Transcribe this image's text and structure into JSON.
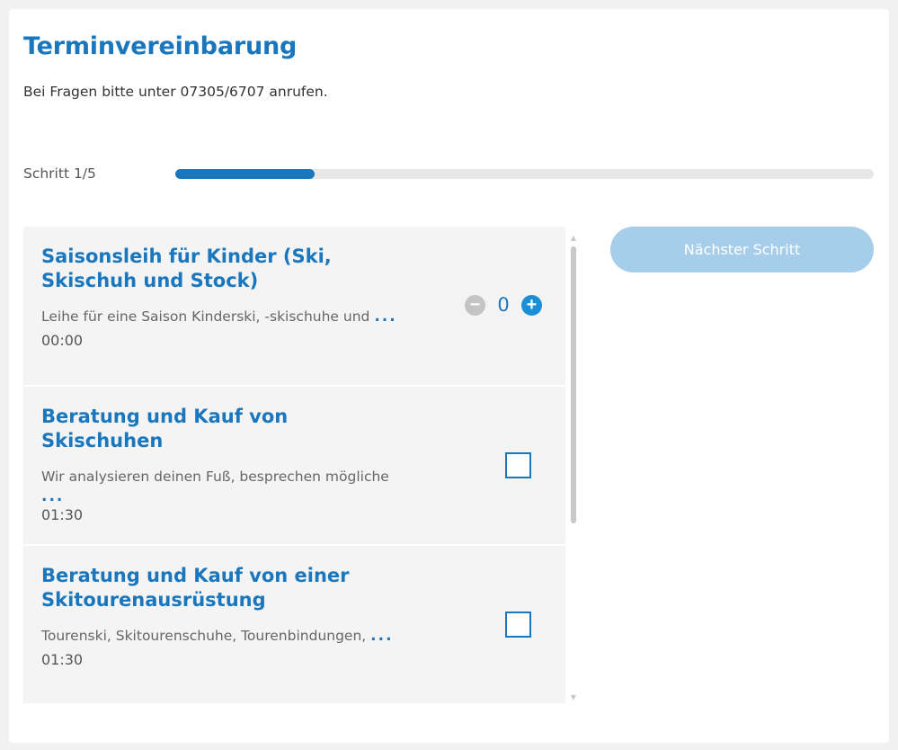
{
  "header": {
    "title": "Terminvereinbarung",
    "subtitle": "Bei Fragen bitte unter 07305/6707 anrufen."
  },
  "progress": {
    "label": "Schritt 1/5",
    "current_step": 1,
    "total_steps": 5,
    "fraction": 0.2
  },
  "services": [
    {
      "title": "Saisonsleih für Kinder (Ski, Skischuh und Stock)",
      "description": "Leihe für eine Saison Kinderski, -skischuhe und",
      "more": "...",
      "duration": "00:00",
      "selector": "quantity",
      "quantity": "0",
      "minus_label": "−",
      "plus_label": "+"
    },
    {
      "title": "Beratung und Kauf von Skischuhen",
      "description": "Wir analysieren deinen Fuß, besprechen mögliche",
      "more": "...",
      "duration": "01:30",
      "selector": "checkbox"
    },
    {
      "title": "Beratung und Kauf von einer Skitourenausrüstung",
      "description": "Tourenski, Skitourenschuhe, Tourenbindungen,",
      "more": "...",
      "duration": "01:30",
      "selector": "checkbox"
    }
  ],
  "actions": {
    "next_label": "Nächster Schritt"
  },
  "colors": {
    "accent": "#1a77bd",
    "button_disabled": "#a6cdea",
    "card_bg": "#f4f4f4"
  }
}
